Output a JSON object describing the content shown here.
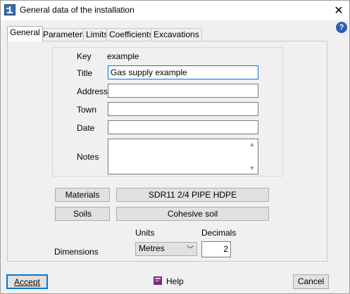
{
  "window": {
    "title": "General data of the installation",
    "close_glyph": "✕",
    "help_glyph": "?"
  },
  "tabs": [
    {
      "label": "General",
      "active": true
    },
    {
      "label": "Parameters",
      "active": false
    },
    {
      "label": "Limits",
      "active": false
    },
    {
      "label": "Coefficients",
      "active": false
    },
    {
      "label": "Excavations",
      "active": false
    }
  ],
  "general": {
    "key_label": "Key",
    "key_value": "example",
    "title_label": "Title",
    "title_value": "Gas supply example",
    "address_label": "Address",
    "address_value": "",
    "town_label": "Town",
    "town_value": "",
    "date_label": "Date",
    "date_value": "",
    "notes_label": "Notes",
    "notes_value": ""
  },
  "materials": {
    "button_label": "Materials",
    "value": "SDR11 2/4 PIPE HDPE"
  },
  "soils": {
    "button_label": "Soils",
    "value": "Cohesive soil"
  },
  "dimensions": {
    "label": "Dimensions",
    "units_label": "Units",
    "units_value": "Metres",
    "decimals_label": "Decimals",
    "decimals_value": "2"
  },
  "footer": {
    "accept_label": "Accept",
    "help_label": "Help",
    "cancel_label": "Cancel"
  },
  "colors": {
    "focus_border": "#0078d7",
    "dialog_bg": "#f0f0f0"
  }
}
